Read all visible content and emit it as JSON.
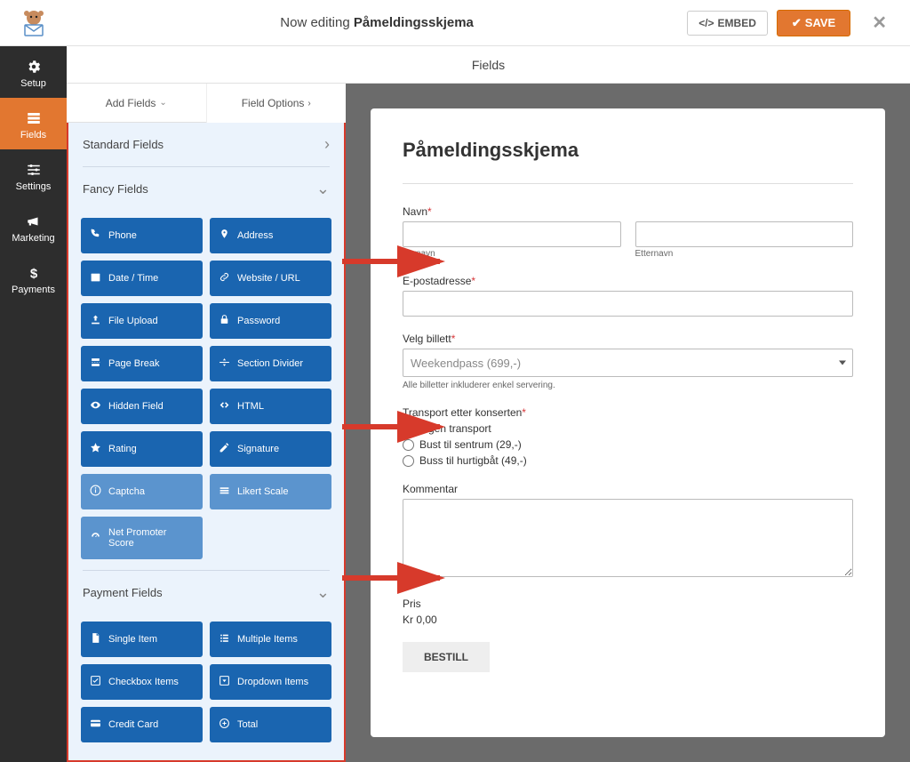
{
  "topbar": {
    "editing_prefix": "Now editing ",
    "form_name": "Påmeldingsskjema",
    "embed": "EMBED",
    "save": "SAVE"
  },
  "nav": {
    "setup": "Setup",
    "fields": "Fields",
    "settings": "Settings",
    "marketing": "Marketing",
    "payments": "Payments"
  },
  "subheader": "Fields",
  "tabs": {
    "add": "Add Fields",
    "options": "Field Options"
  },
  "sections": {
    "standard": "Standard Fields",
    "fancy": "Fancy Fields",
    "payment": "Payment Fields"
  },
  "fancy_fields": [
    {
      "label": "Phone",
      "icon": "phone"
    },
    {
      "label": "Address",
      "icon": "pin"
    },
    {
      "label": "Date / Time",
      "icon": "calendar"
    },
    {
      "label": "Website / URL",
      "icon": "link"
    },
    {
      "label": "File Upload",
      "icon": "upload"
    },
    {
      "label": "Password",
      "icon": "lock"
    },
    {
      "label": "Page Break",
      "icon": "pagebreak"
    },
    {
      "label": "Section Divider",
      "icon": "divider"
    },
    {
      "label": "Hidden Field",
      "icon": "eye"
    },
    {
      "label": "HTML",
      "icon": "code"
    },
    {
      "label": "Rating",
      "icon": "star"
    },
    {
      "label": "Signature",
      "icon": "pencil"
    },
    {
      "label": "Captcha",
      "icon": "info",
      "light": true
    },
    {
      "label": "Likert Scale",
      "icon": "scale",
      "light": true
    },
    {
      "label": "Net Promoter Score",
      "icon": "dashboard",
      "light": true,
      "single": true
    }
  ],
  "payment_fields": [
    {
      "label": "Single Item",
      "icon": "file"
    },
    {
      "label": "Multiple Items",
      "icon": "list"
    },
    {
      "label": "Checkbox Items",
      "icon": "checkbox"
    },
    {
      "label": "Dropdown Items",
      "icon": "dropdown"
    },
    {
      "label": "Credit Card",
      "icon": "card"
    },
    {
      "label": "Total",
      "icon": "total"
    }
  ],
  "form": {
    "title": "Påmeldingsskjema",
    "name_label": "Navn",
    "first_sublabel": "Fornavn",
    "last_sublabel": "Etternavn",
    "email_label": "E-postadresse",
    "ticket_label": "Velg billett",
    "ticket_placeholder": "Weekendpass (699,-)",
    "ticket_help": "Alle billetter inkluderer enkel servering.",
    "transport_label": "Transport etter konserten",
    "transport_options": [
      "Ingen transport",
      "Bust til sentrum (29,-)",
      "Buss til hurtigbåt (49,-)"
    ],
    "comment_label": "Kommentar",
    "price_label": "Pris",
    "price_value": "Kr 0,00",
    "submit": "BESTILL"
  }
}
